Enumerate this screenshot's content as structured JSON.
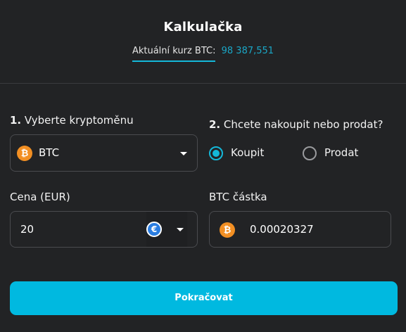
{
  "header": {
    "title": "Kalkulačka",
    "rate_label": "Aktuální kurz BTC:",
    "rate_value": "98 387,551"
  },
  "step1": {
    "number": "1.",
    "label": "Vyberte kryptoměnu",
    "selected": "BTC",
    "coin_icon": "bitcoin-icon",
    "coin_symbol": "₿"
  },
  "step2": {
    "number": "2.",
    "label": "Chcete nakoupit nebo prodat?",
    "options": [
      {
        "label": "Koupit",
        "checked": true
      },
      {
        "label": "Prodat",
        "checked": false
      }
    ]
  },
  "price": {
    "label": "Cena (EUR)",
    "value": "20",
    "currency_icon": "euro-icon",
    "currency_symbol": "€"
  },
  "amount": {
    "label": "BTC částka",
    "value": "0.00020327",
    "coin_icon": "bitcoin-icon",
    "coin_symbol": "₿"
  },
  "submit": {
    "label": "Pokračovat"
  },
  "colors": {
    "background": "#222325",
    "accent": "#00b9e0",
    "bitcoin": "#f28f23",
    "euro": "#2a7de1"
  }
}
